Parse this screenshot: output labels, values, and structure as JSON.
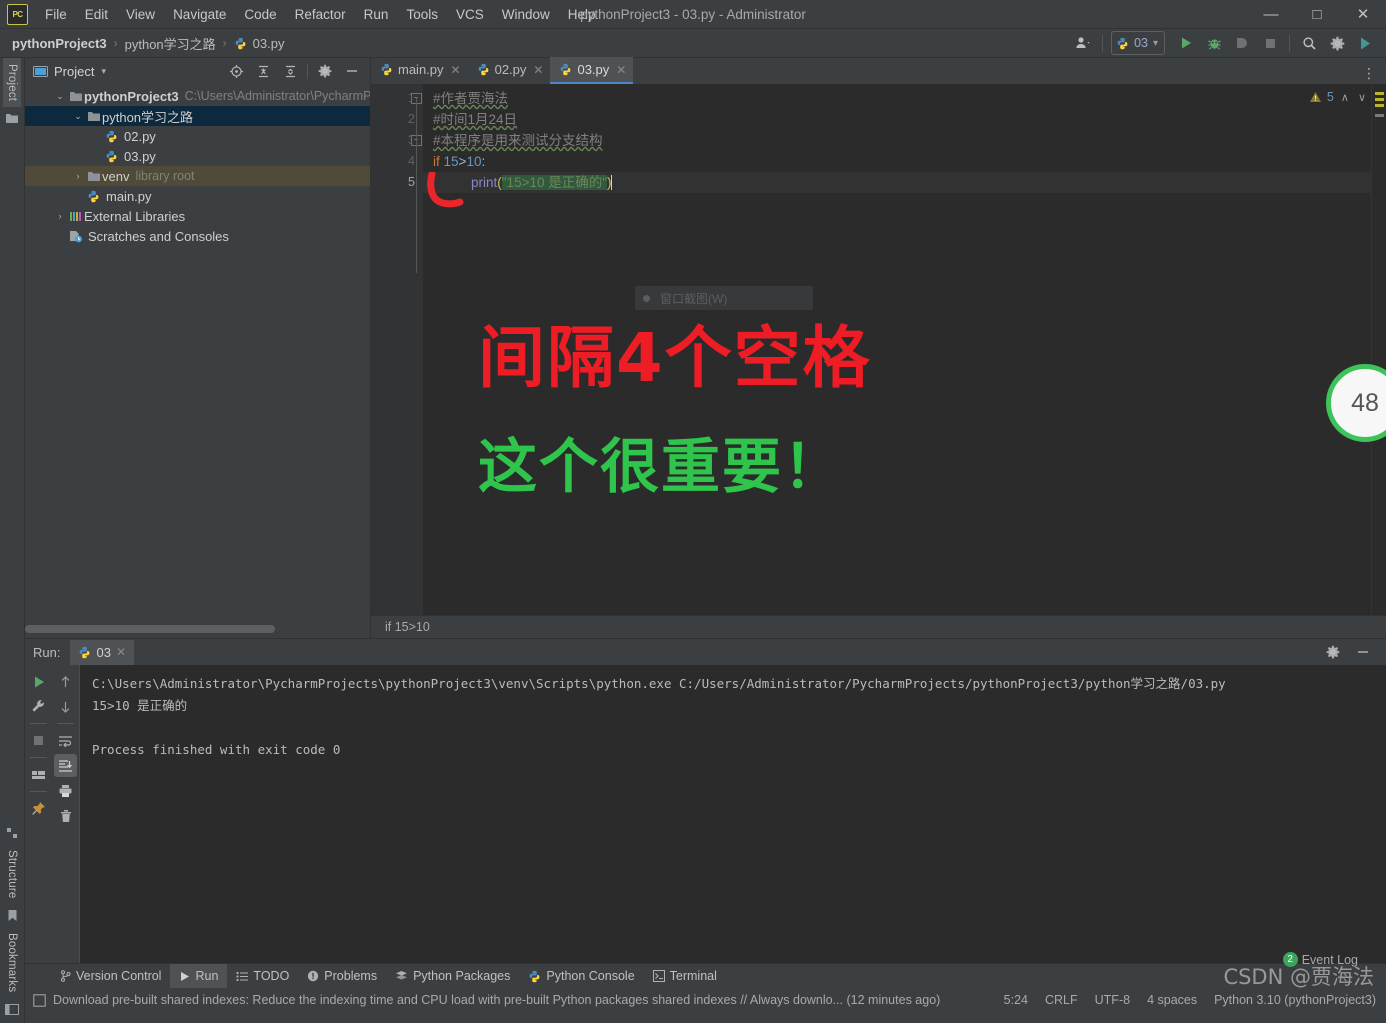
{
  "window": {
    "title": "pythonProject3 - 03.py - Administrator",
    "app_icon": "pycharm-logo-icon",
    "controls": {
      "minimize": "—",
      "maximize": "□",
      "close": "✕"
    }
  },
  "menu": {
    "items": [
      "File",
      "Edit",
      "View",
      "Navigate",
      "Code",
      "Refactor",
      "Run",
      "Tools",
      "VCS",
      "Window",
      "Help"
    ]
  },
  "navbar": {
    "crumbs": [
      {
        "label": "pythonProject3",
        "bold": true,
        "icon": null
      },
      {
        "label": "python学习之路",
        "bold": false,
        "icon": null
      },
      {
        "label": "03.py",
        "bold": false,
        "icon": "python-file-icon"
      }
    ],
    "separator": "›",
    "run_config": {
      "name": "03",
      "icon": "python-file-icon",
      "chevron": "▾"
    },
    "buttons": [
      {
        "name": "user-account-button",
        "icon": "user-icon"
      },
      {
        "name": "run-button",
        "icon": "run-icon"
      },
      {
        "name": "debug-button",
        "icon": "debug-icon"
      },
      {
        "name": "run-with-coverage-button",
        "icon": "coverage-icon"
      },
      {
        "name": "stop-button",
        "icon": "stop-icon"
      },
      {
        "name": "search-everywhere-button",
        "icon": "search-icon"
      },
      {
        "name": "settings-button",
        "icon": "gear-icon"
      },
      {
        "name": "updates-button",
        "icon": "ide-updates-icon"
      }
    ]
  },
  "left_rail": {
    "top": [
      {
        "label": "Project",
        "active": true,
        "icon": "project-icon"
      }
    ],
    "bottom": [
      {
        "label": "Structure",
        "icon": "structure-icon"
      },
      {
        "label": "Bookmarks",
        "icon": "bookmarks-icon"
      }
    ]
  },
  "project_panel": {
    "title": "Project",
    "title_chevron": "▾",
    "header_icons": [
      "scroll-from-source-icon",
      "expand-all-icon",
      "collapse-all-icon",
      "gear-icon",
      "hide-icon"
    ],
    "tree": [
      {
        "depth": 0,
        "arrow": "⌄",
        "icon": "folder-icon",
        "label": "pythonProject3",
        "bold": true,
        "sub": "C:\\Users\\Administrator\\PycharmPro",
        "state": "normal"
      },
      {
        "depth": 1,
        "arrow": "⌄",
        "icon": "folder-icon",
        "label": "python学习之路",
        "bold": false,
        "sub": "",
        "state": "selected"
      },
      {
        "depth": 2,
        "arrow": "",
        "icon": "python-file-icon",
        "label": "02.py",
        "bold": false,
        "sub": "",
        "state": "normal"
      },
      {
        "depth": 2,
        "arrow": "",
        "icon": "python-file-icon",
        "label": "03.py",
        "bold": false,
        "sub": "",
        "state": "normal"
      },
      {
        "depth": 1,
        "arrow": "›",
        "icon": "folder-icon",
        "label": "venv",
        "bold": false,
        "sub": "library root",
        "state": "highlight"
      },
      {
        "depth": 2,
        "arrow": "",
        "icon": "python-file-icon",
        "label": "main.py",
        "bold": false,
        "sub": "",
        "state": "normal"
      },
      {
        "depth": 0,
        "arrow": "›",
        "icon": "external-libraries-icon",
        "label": "External Libraries",
        "bold": false,
        "sub": "",
        "state": "normal"
      },
      {
        "depth": 0,
        "arrow": "",
        "icon": "scratches-icon",
        "label": "Scratches and Consoles",
        "bold": false,
        "sub": "",
        "state": "normal"
      }
    ]
  },
  "editor": {
    "tabs": [
      {
        "label": "main.py",
        "icon": "python-file-icon",
        "active": false,
        "close": "✕"
      },
      {
        "label": "02.py",
        "icon": "python-file-icon",
        "active": false,
        "close": "✕"
      },
      {
        "label": "03.py",
        "icon": "python-file-icon",
        "active": true,
        "close": "✕"
      }
    ],
    "overflow_icon": "⋮",
    "line_numbers": [
      "1",
      "2",
      "3",
      "4",
      "5"
    ],
    "lines": [
      {
        "n": 1,
        "type": "comment",
        "text": "#作者贾海法",
        "fold": "minus"
      },
      {
        "n": 2,
        "type": "comment",
        "text": "#时间1月24日",
        "fold": ""
      },
      {
        "n": 3,
        "type": "comment",
        "text": "#本程序是用来测试分支结构",
        "fold": "minus"
      },
      {
        "n": 4,
        "type": "code",
        "kw": "if",
        "num1": "15",
        "op": ">",
        "num2": "10",
        "colon": ":",
        "fold": ""
      },
      {
        "n": 5,
        "type": "print",
        "fn": "print",
        "open": "(",
        "str": "\"15>10 是正确的\"",
        "close": ")",
        "fold": ""
      }
    ],
    "inspections": {
      "icon": "warning-icon",
      "count": "5",
      "up": "∧",
      "down": "∨"
    },
    "breadcrumb": "if 15>10"
  },
  "run_panel": {
    "label": "Run:",
    "tab": {
      "label": "03",
      "icon": "python-file-icon",
      "close": "✕"
    },
    "header_icons": [
      "gear-icon",
      "hide-icon"
    ],
    "left_tools": [
      {
        "name": "rerun-button",
        "icon": "run-icon"
      },
      {
        "name": "edit-configurations-button",
        "icon": "wrench-icon"
      },
      {
        "name": "stop-process-button",
        "icon": "stop-icon"
      },
      {
        "name": "layout-settings-button",
        "icon": "layout-icon"
      },
      {
        "name": "pin-tab-button",
        "icon": "pin-icon"
      }
    ],
    "right_tools": [
      {
        "name": "up-occurrence-button",
        "icon": "arrow-up-icon"
      },
      {
        "name": "down-occurrence-button",
        "icon": "arrow-down-icon"
      },
      {
        "name": "soft-wrap-button",
        "icon": "wrap-icon"
      },
      {
        "name": "scroll-to-end-button",
        "icon": "scroll-end-icon",
        "selected": true
      },
      {
        "name": "print-button",
        "icon": "print-icon"
      },
      {
        "name": "clear-all-button",
        "icon": "trash-icon"
      }
    ],
    "output": [
      "C:\\Users\\Administrator\\PycharmProjects\\pythonProject3\\venv\\Scripts\\python.exe C:/Users/Administrator/PycharmProjects/pythonProject3/python学习之路/03.py",
      "15>10 是正确的",
      "",
      "Process finished with exit code 0"
    ]
  },
  "bottom_tabs": [
    {
      "label": "Version Control",
      "icon": "branch-icon",
      "active": false
    },
    {
      "label": "Run",
      "icon": "run-icon",
      "active": true
    },
    {
      "label": "TODO",
      "icon": "todo-icon",
      "active": false
    },
    {
      "label": "Problems",
      "icon": "problems-icon",
      "active": false
    },
    {
      "label": "Python Packages",
      "icon": "packages-icon",
      "active": false
    },
    {
      "label": "Python Console",
      "icon": "python-console-icon",
      "active": false
    },
    {
      "label": "Terminal",
      "icon": "terminal-icon",
      "active": false
    }
  ],
  "status_bar": {
    "message_icon": "notification-icon",
    "message": "Download pre-built shared indexes: Reduce the indexing time and CPU load with pre-built Python packages shared indexes // Always downlo... (12 minutes ago)",
    "caret_position": "5:24",
    "line_separator": "CRLF",
    "encoding": "UTF-8",
    "indent": "4 spaces",
    "interpreter": "Python 3.10 (pythonProject3)",
    "event_log": {
      "label": "Event Log",
      "count": "2"
    }
  },
  "annotations": {
    "red_text": "间隔4个空格",
    "green_text": "这个很重要！",
    "red_stroke": "hand-drawn-indent-marker",
    "ghost_tooltip": "窗口截图(W)",
    "circle_badge": "48",
    "watermark": "CSDN @贾海法"
  },
  "colors": {
    "panel_bg": "#3c3f41",
    "editor_bg": "#2b2b2b",
    "gutter_bg": "#313335",
    "selection_blue": "#0d293e",
    "tab_active": "#4e5254",
    "accent_blue": "#4a88c7",
    "keyword_orange": "#cc7832",
    "number_blue": "#6897bb",
    "string_green": "#6a8759",
    "function_purple": "#8888c6",
    "comment_gray": "#808080",
    "annotation_red": "#ee1c25",
    "annotation_green": "#2fc44b"
  }
}
